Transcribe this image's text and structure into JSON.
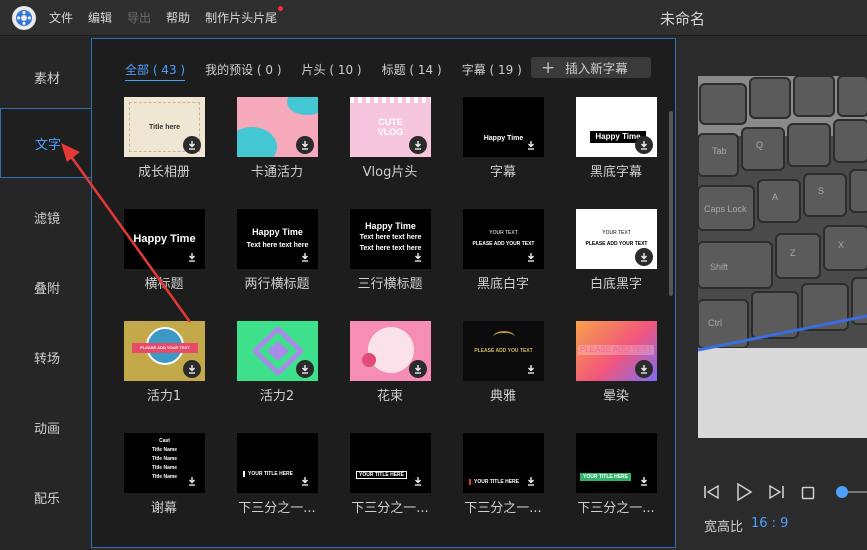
{
  "menu": [
    {
      "label": "文件",
      "disabled": false
    },
    {
      "label": "编辑",
      "disabled": false
    },
    {
      "label": "导出",
      "disabled": true
    },
    {
      "label": "帮助",
      "disabled": false
    },
    {
      "label": "制作片头片尾",
      "disabled": false
    }
  ],
  "document_title": "未命名",
  "sidebar": [
    "素材",
    "文字",
    "滤镜",
    "叠附",
    "转场",
    "动画",
    "配乐"
  ],
  "active_sidebar": "文字",
  "tabs": [
    "全部 ( 43 )",
    "我的预设 ( 0 )",
    "片头 ( 10 )",
    "标题 ( 14 )",
    "字幕 ( 19 )"
  ],
  "active_tab": "全部 ( 43 )",
  "add_subtitle_label": "插入新字幕",
  "templates": [
    {
      "label": "成长相册",
      "thumb_text": [
        "Title here"
      ]
    },
    {
      "label": "卡通活力",
      "thumb_text": []
    },
    {
      "label": "Vlog片头",
      "thumb_text": [
        "CUTE",
        "VLOG"
      ]
    },
    {
      "label": "字幕",
      "thumb_text": [
        "Happy Time"
      ]
    },
    {
      "label": "黑底字幕",
      "thumb_text": [
        "Happy Time"
      ]
    },
    {
      "label": "横标题",
      "thumb_text": [
        "Happy Time"
      ]
    },
    {
      "label": "两行横标题",
      "thumb_text": [
        "Happy Time",
        "Text here text here"
      ]
    },
    {
      "label": "三行横标题",
      "thumb_text": [
        "Happy Time",
        "Text here text here",
        "Text here text here"
      ]
    },
    {
      "label": "黑底白字",
      "thumb_text": [
        "YOUR TEXT",
        "PLEASE ADD YOUR TEXT"
      ]
    },
    {
      "label": "白底黑字",
      "thumb_text": [
        "YOUR TEXT",
        "PLEASE ADD YOUR TEXT"
      ]
    },
    {
      "label": "活力1",
      "thumb_text": [
        "PLEASE ADD YOUR TEXT"
      ]
    },
    {
      "label": "活力2",
      "thumb_text": []
    },
    {
      "label": "花束",
      "thumb_text": []
    },
    {
      "label": "典雅",
      "thumb_text": [
        "PLEASE ADD YOU TEXT"
      ]
    },
    {
      "label": "晕染",
      "thumb_text": [
        "PLEASE ADD TEXT"
      ]
    },
    {
      "label": "谢幕",
      "thumb_text": [
        "Cast",
        "Title Name",
        "Title Name",
        "Title Name",
        "Title Name"
      ]
    },
    {
      "label": "下三分之一...",
      "thumb_text": [
        "YOUR TITLE HERE"
      ]
    },
    {
      "label": "下三分之一...",
      "thumb_text": [
        "YOUR TITLE HERE"
      ]
    },
    {
      "label": "下三分之一...",
      "thumb_text": [
        "YOUR TITLE HERE"
      ]
    },
    {
      "label": "下三分之一...",
      "thumb_text": [
        "YOUR TITLE HERE"
      ]
    }
  ],
  "preview": {
    "keys": [
      "Tab",
      "Q",
      "Caps Lock",
      "A",
      "S",
      "Shift",
      "Z",
      "X",
      "Ctrl"
    ]
  },
  "aspect_ratio_label": "宽高比",
  "aspect_ratio_value": "16 : 9",
  "colors": {
    "accent": "#4da1ff",
    "arrow": "#e53935"
  }
}
